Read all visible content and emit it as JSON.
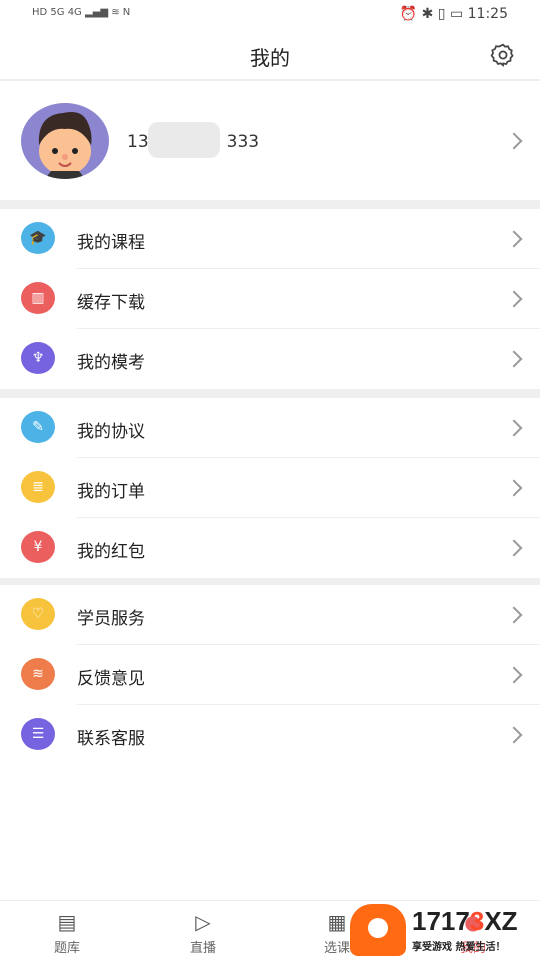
{
  "status_bar": {
    "left": "HD 5G 4G",
    "time": "11:25"
  },
  "header": {
    "title": "我的"
  },
  "profile": {
    "phone_prefix": "13",
    "phone_suffix": "333"
  },
  "groups": [
    [
      {
        "label": "我的课程",
        "icon": "graduation-cap",
        "color": "#4db3e6"
      },
      {
        "label": "缓存下载",
        "icon": "bar-chart",
        "color": "#ec5f5f"
      },
      {
        "label": "我的模考",
        "icon": "trophy",
        "color": "#7563e0"
      }
    ],
    [
      {
        "label": "我的协议",
        "icon": "edit",
        "color": "#4db3e6"
      },
      {
        "label": "我的订单",
        "icon": "list",
        "color": "#f8c33c"
      },
      {
        "label": "我的红包",
        "icon": "red-packet",
        "color": "#ec5f5f"
      }
    ],
    [
      {
        "label": "学员服务",
        "icon": "heart",
        "color": "#f8c33c"
      },
      {
        "label": "反馈意见",
        "icon": "stack",
        "color": "#ef7d4c"
      },
      {
        "label": "联系客服",
        "icon": "chat",
        "color": "#7563e0"
      }
    ]
  ],
  "bottom_nav": [
    {
      "label": "题库",
      "icon": "docs"
    },
    {
      "label": "直播",
      "icon": "play"
    },
    {
      "label": "选课",
      "icon": "calendar"
    },
    {
      "label": "我的",
      "icon": "user",
      "active": true,
      "active_color": "#ec5f5f"
    }
  ],
  "watermark": {
    "brand": "17173XZ",
    "slogan": "享受游戏 热爱生活！"
  }
}
